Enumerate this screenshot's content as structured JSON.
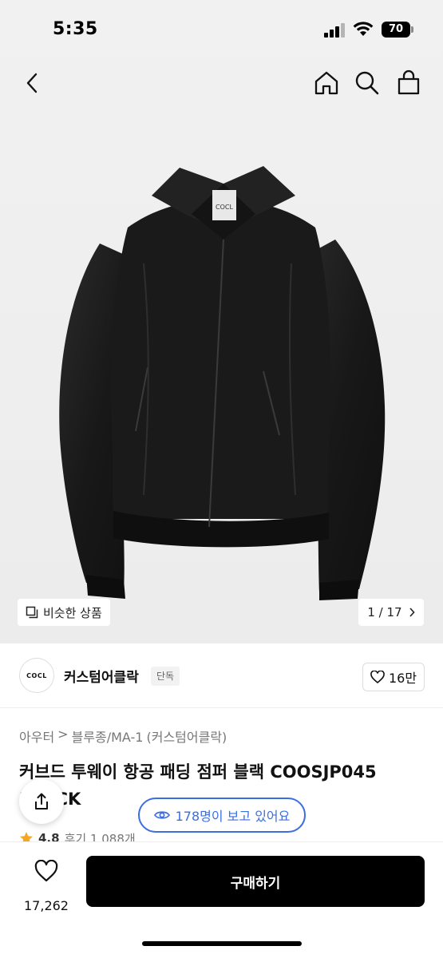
{
  "status_bar": {
    "time": "5:35",
    "battery": "70"
  },
  "nav": {
    "back": "back-icon",
    "home": "home-icon",
    "search": "search-icon",
    "cart": "shopping-bag-icon"
  },
  "gallery": {
    "logo_text": "COCL",
    "similar_label": "비슷한 상품",
    "pager": "1 / 17"
  },
  "brand": {
    "logo_text": "COCL",
    "name": "커스텀어클락",
    "badge": "단독",
    "likes": "16만"
  },
  "product": {
    "breadcrumb": [
      "아우터",
      "블루종/MA-1",
      "(커스텀어클락)"
    ],
    "breadcrumb_sep": ">",
    "title": "커브드 투웨이 항공 패딩 점퍼 블랙 COOSJP045 BLACK",
    "viewers": "178명이 보고 있어요",
    "rating": "4.8",
    "reviews": "후기 1,088개"
  },
  "bottom": {
    "wish_count": "17,262",
    "buy_label": "구매하기"
  },
  "colors": {
    "accent_blue": "#3d6ee0",
    "star": "#f5a623",
    "buy_bg": "#000000"
  }
}
